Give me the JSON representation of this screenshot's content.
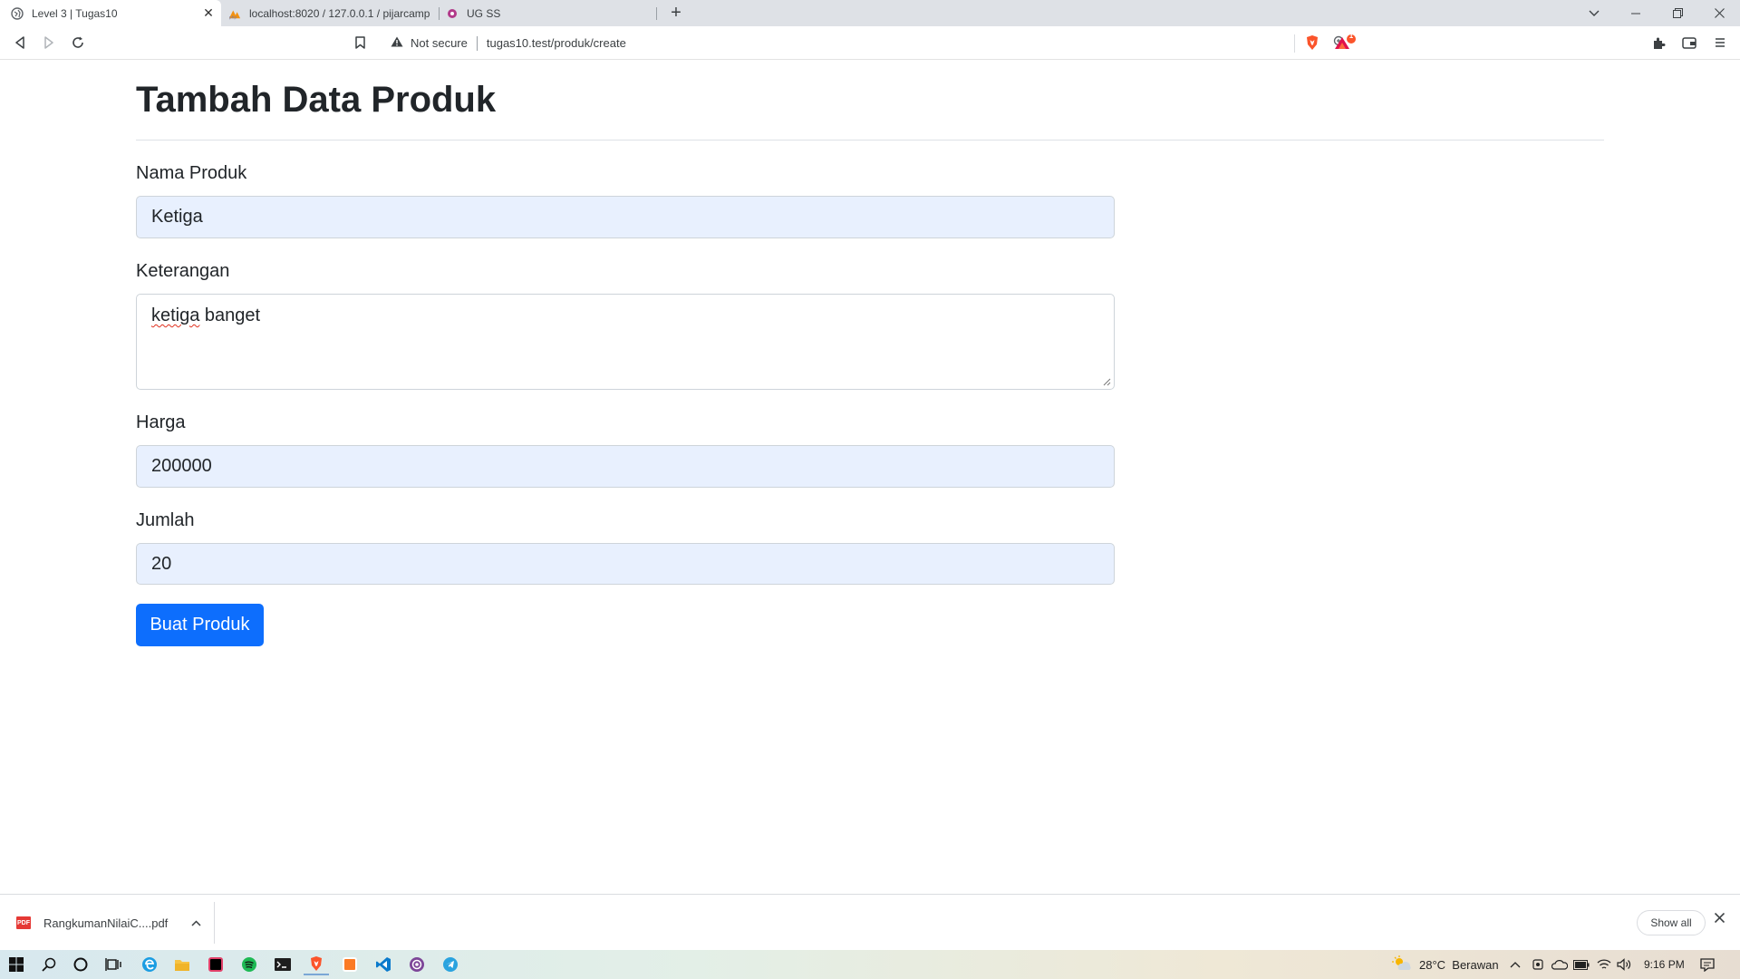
{
  "browser": {
    "tabs": [
      {
        "title": "Level 3 | Tugas10",
        "active": true
      },
      {
        "title": "localhost:8020 / 127.0.0.1 / pijarcamp",
        "active": false
      },
      {
        "title": "UG SS",
        "active": false
      }
    ],
    "security_label": "Not secure",
    "url": "tugas10.test/produk/create",
    "brave_badge": "1"
  },
  "page": {
    "title": "Tambah Data Produk",
    "form": {
      "nama_label": "Nama Produk",
      "nama_value": "Ketiga",
      "keterangan_label": "Keterangan",
      "keterangan_word1": "ketiga",
      "keterangan_word2": " banget",
      "harga_label": "Harga",
      "harga_value": "200000",
      "jumlah_label": "Jumlah",
      "jumlah_value": "20",
      "submit_label": "Buat Produk"
    }
  },
  "downloads": {
    "file_name": "RangkumanNilaiC....pdf",
    "file_icon_text": "PDF",
    "show_all_label": "Show all"
  },
  "taskbar": {
    "weather": "28°C  Berawan",
    "time": "9:16 PM"
  },
  "colors": {
    "primary_button": "#0d6efd",
    "autofill_background": "#e8f0fe",
    "brave_orange": "#fb542b"
  }
}
